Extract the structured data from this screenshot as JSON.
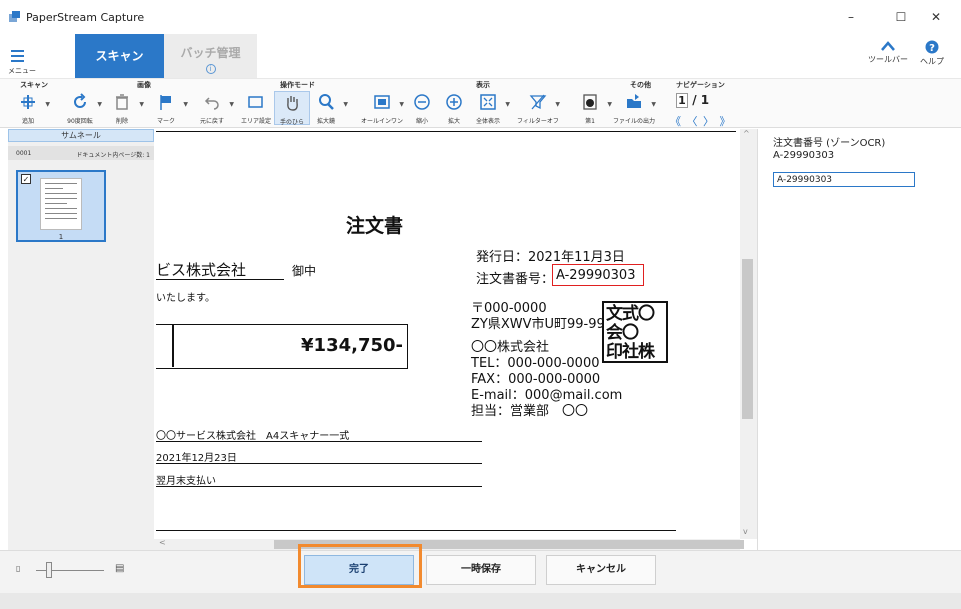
{
  "window": {
    "title": "PaperStream Capture",
    "minimize": "–",
    "maximize": "☐",
    "close": "✕"
  },
  "top": {
    "menu_label": "メニュー",
    "tab_scan": "スキャン",
    "tab_batch": "バッチ管理",
    "batch_info": "i",
    "toolbar_label": "ツールバー",
    "help_label": "ヘルプ"
  },
  "ribbon": {
    "groups": {
      "scan": "スキャン",
      "image": "画像",
      "mode": "操作モード",
      "view": "表示",
      "other": "その他",
      "nav": "ナビゲーション"
    },
    "buttons": {
      "add": "追加",
      "rotate": "90度回転",
      "delete": "削除",
      "mark": "マーク",
      "undo": "元に戻す",
      "area": "エリア設定",
      "hand": "手のひら",
      "zoom": "拡大鏡",
      "all_in_one": "オールインワン",
      "zoom_out": "縮小",
      "zoom_in": "拡大",
      "fit_all": "全体表示",
      "filter_off": "フィルターオフ",
      "page1": "第1",
      "file_out": "ファイルの出力"
    },
    "nav": {
      "current": "1",
      "separator": "/",
      "total": "1",
      "arrows": "《 〈 〉 》"
    }
  },
  "thumbnails": {
    "header": "サムネール",
    "doc_number": "0001",
    "doc_pages": "ドキュメント内ページ数: 1",
    "page_number": "1",
    "checked": "✓"
  },
  "document": {
    "title": "注文書",
    "customer": "ビス株式会社",
    "honorific": "御中",
    "greeting": "いたします。",
    "amount": "¥134,750-",
    "issue_date": "発行日：2021年11月3日",
    "order_label": "注文書番号：",
    "order_number": "A-29990303",
    "postal": "〒000-0000",
    "address": "ZY県XWV市U町99-99",
    "company": "〇〇株式会社",
    "tel": "TEL：000-000-0000",
    "fax": "FAX：000-000-0000",
    "email": "E-mail：000@mail.com",
    "contact": "担当：営業部　〇〇",
    "item": "〇〇サービス株式会社　A4スキャナー一式",
    "delivery": "2021年12月23日",
    "payment": "翌月末支払い",
    "stamp": "文式〇\n会〇\n印社株"
  },
  "ocr_panel": {
    "label": "注文書番号 (ゾーンOCR)",
    "value_text": "A-29990303",
    "input_value": "A-29990303"
  },
  "bottom": {
    "zoom_small": "▯",
    "zoom_big": "▤",
    "done": "完了",
    "save_temp": "一時保存",
    "cancel": "キャンセル"
  }
}
